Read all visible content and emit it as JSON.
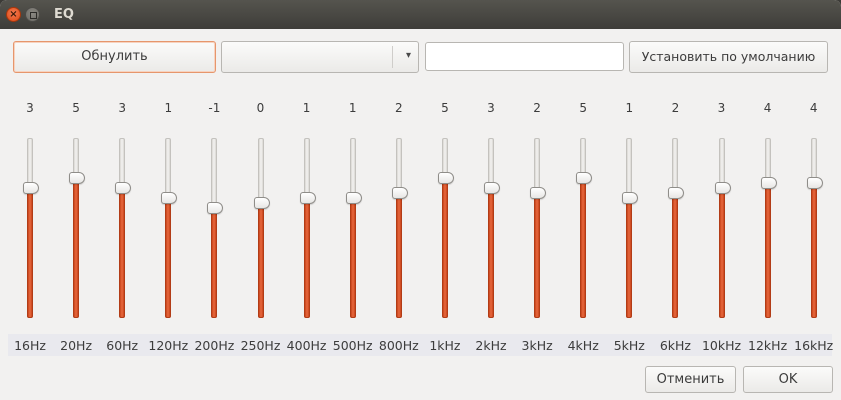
{
  "window": {
    "title": "EQ",
    "close_glyph": "×",
    "close_icon": "close-icon",
    "maximize_icon": "maximize-icon"
  },
  "toolbar": {
    "reset_label": "Обнулить",
    "preset_selected": "",
    "preset_name_value": "",
    "set_default_label": "Установить по умолчанию",
    "combo_arrow_glyph": "▾"
  },
  "range": {
    "min": -10,
    "max": 10
  },
  "bands": [
    {
      "freq": "16Hz",
      "value": "3"
    },
    {
      "freq": "20Hz",
      "value": "5"
    },
    {
      "freq": "60Hz",
      "value": "3"
    },
    {
      "freq": "120Hz",
      "value": "1"
    },
    {
      "freq": "200Hz",
      "value": "-1"
    },
    {
      "freq": "250Hz",
      "value": "0"
    },
    {
      "freq": "400Hz",
      "value": "1"
    },
    {
      "freq": "500Hz",
      "value": "1"
    },
    {
      "freq": "800Hz",
      "value": "2"
    },
    {
      "freq": "1kHz",
      "value": "5"
    },
    {
      "freq": "2kHz",
      "value": "3"
    },
    {
      "freq": "3kHz",
      "value": "2"
    },
    {
      "freq": "4kHz",
      "value": "5"
    },
    {
      "freq": "5kHz",
      "value": "1"
    },
    {
      "freq": "6kHz",
      "value": "2"
    },
    {
      "freq": "10kHz",
      "value": "3"
    },
    {
      "freq": "12kHz",
      "value": "4"
    },
    {
      "freq": "16kHz",
      "value": "4"
    }
  ],
  "footer": {
    "cancel_label": "Отменить",
    "ok_label": "OK"
  },
  "colors": {
    "accent": "#e0582a",
    "window_bg": "#f2f1f0",
    "titlebar_bg": "#3e3d39"
  }
}
